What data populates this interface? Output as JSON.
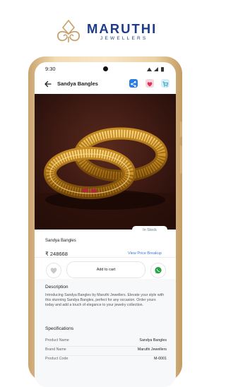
{
  "brand": {
    "name": "MARUTHI",
    "subtitle": "JEWELLERS",
    "color": "#1f3c8a",
    "accent": "#c8a06a"
  },
  "status_bar": {
    "time": "9:30"
  },
  "app_bar": {
    "title": "Sandya Bangles",
    "back_icon": "arrow-left-icon",
    "actions": [
      "share-icon",
      "heart-icon",
      "cart-icon"
    ]
  },
  "product": {
    "stock_status": "In Stock",
    "name": "Sandya Bangles",
    "price": "₹ 248668",
    "price_breakup_link": "View Price Breakup"
  },
  "actions": {
    "add_to_cart": "Add to cart",
    "wishlist_icon": "heart-icon",
    "whatsapp_icon": "whatsapp-icon"
  },
  "description": {
    "title": "Description",
    "text": "Introducing Sandya Bangles by Maruthi Jewellers. Elevate your style with this stunning Sandya Bangles, perfect for any occasion. Order yours today and add a touch of elegance to your jewelry collection."
  },
  "specifications": {
    "title": "Specifications",
    "rows": [
      {
        "label": "Product Name",
        "value": "Sandya Bangles"
      },
      {
        "label": "Brand Name",
        "value": "Maruthi Jewellers"
      },
      {
        "label": "Product Code",
        "value": "M-0001"
      }
    ]
  },
  "colors": {
    "share": "#2a7de1",
    "wishlist": "#e0315a",
    "cart": "#1e9bc4",
    "link": "#3a78d8",
    "whatsapp": "#25a244",
    "gold": "#d9a53e"
  }
}
